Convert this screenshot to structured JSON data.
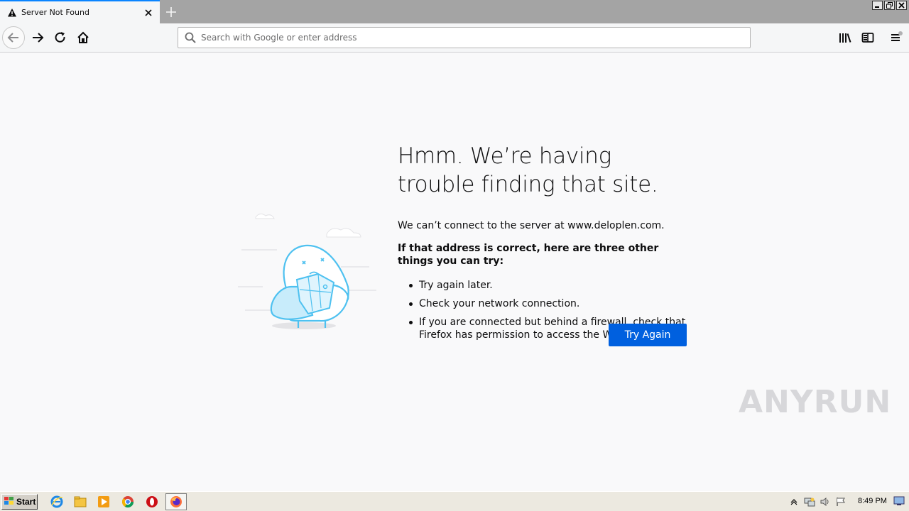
{
  "window": {
    "tab_title": "Server Not Found",
    "new_tab_symbol": "+"
  },
  "toolbar": {
    "url_placeholder": "Search with Google or enter address",
    "url_value": ""
  },
  "icons": {
    "tab": "warning-icon",
    "nav": [
      "back-arrow-icon",
      "forward-arrow-icon",
      "reload-icon",
      "home-icon"
    ],
    "right": [
      "library-icon",
      "sidebar-icon",
      "hamburger-menu-icon"
    ]
  },
  "error": {
    "title": "Hmm. We’re having trouble finding that site.",
    "description": "We can’t connect to the server at www.deloplen.com.",
    "strong": "If that address is correct, here are three other things you can try:",
    "tips": [
      "Try again later.",
      "Check your network connection.",
      "If you are connected but behind a firewall, check that Firefox has permission to access the Web."
    ],
    "button_label": "Try Again"
  },
  "watermark": {
    "text_left": "ANY",
    "text_right": "RUN"
  },
  "taskbar": {
    "start_label": "Start",
    "clock": "8:49 PM",
    "apps": [
      "internet-explorer-icon",
      "file-explorer-icon",
      "media-player-icon",
      "chrome-icon",
      "opera-icon",
      "firefox-icon"
    ]
  },
  "colors": {
    "accent": "#0a84ff",
    "button": "#0060df",
    "illustration": "#4ec1f0"
  }
}
